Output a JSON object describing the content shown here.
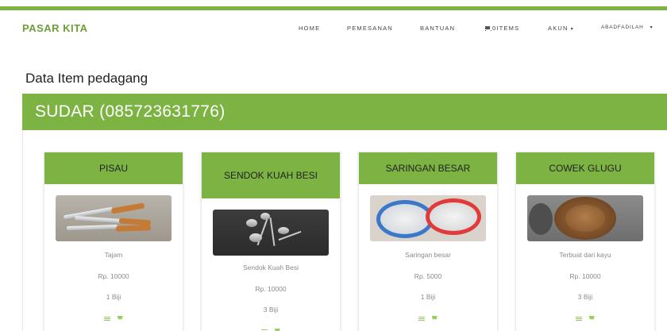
{
  "navbar": {
    "brand": "PASAR KITA",
    "items": [
      {
        "label": "HOME"
      },
      {
        "label": "PEMESANAN"
      },
      {
        "label": "BANTUAN"
      },
      {
        "label": "0ITEMS"
      },
      {
        "label": "AKUN"
      },
      {
        "label": "ABADFADILAH"
      }
    ]
  },
  "page": {
    "title": "Data Item pedagang"
  },
  "merchant": {
    "name": "SUDAR (085723631776)"
  },
  "items": [
    {
      "name": "PISAU",
      "description": "Tajam",
      "price": "Rp. 10000",
      "stock": "1 Biji",
      "image": "knife-image"
    },
    {
      "name": "SENDOK KUAH BESI",
      "description": "Sendok Kuah Besi",
      "price": "Rp. 10000",
      "stock": "3 Biji",
      "image": "ladle-image"
    },
    {
      "name": "SARINGAN BESAR",
      "description": "Saringan besar",
      "price": "Rp. 5000",
      "stock": "1 Biji",
      "image": "strainer-image"
    },
    {
      "name": "COWEK GLUGU",
      "description": "Terbuat dari kayu",
      "price": "Rp. 10000",
      "stock": "3 Biji",
      "image": "wooden-mortar-image"
    }
  ],
  "colors": {
    "accent": "#7cb342",
    "brand": "#6a9f35",
    "muted_text": "#8a8a8a"
  },
  "icons": {
    "cart": "cart-icon",
    "caret": "caret-down-icon",
    "list": "list-icon",
    "add_to_cart": "cart-icon"
  }
}
